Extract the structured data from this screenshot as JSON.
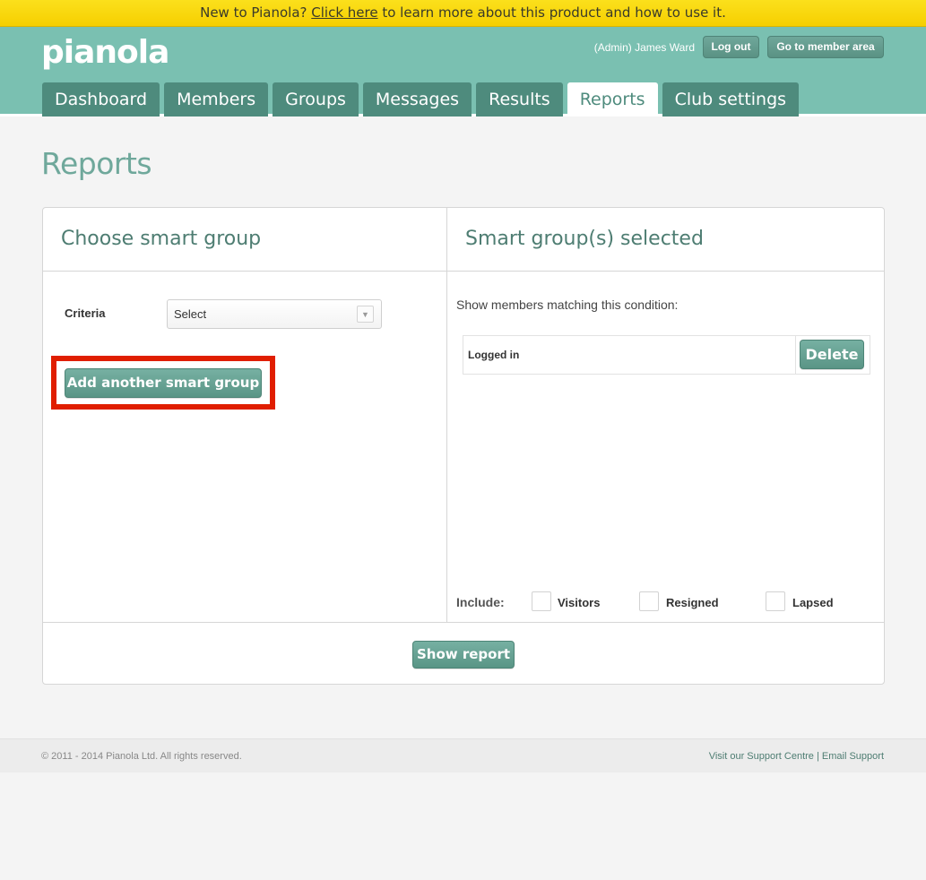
{
  "banner": {
    "prefix": "New to Pianola? ",
    "link": "Click here",
    "suffix": " to learn more about this product and how to use it."
  },
  "header": {
    "logo": "pianola",
    "admin_user": "(Admin) James Ward",
    "logout_label": "Log out",
    "member_area_label": "Go to member area"
  },
  "tabs": [
    {
      "label": "Dashboard",
      "active": false
    },
    {
      "label": "Members",
      "active": false
    },
    {
      "label": "Groups",
      "active": false
    },
    {
      "label": "Messages",
      "active": false
    },
    {
      "label": "Results",
      "active": false
    },
    {
      "label": "Reports",
      "active": true
    },
    {
      "label": "Club settings",
      "active": false
    }
  ],
  "page": {
    "title": "Reports"
  },
  "left_panel": {
    "heading": "Choose smart group",
    "criteria_label": "Criteria",
    "criteria_value": "Select",
    "add_button": "Add another smart group"
  },
  "right_panel": {
    "heading": "Smart group(s) selected",
    "condition_text": "Show members matching this condition:",
    "conditions": [
      {
        "name": "Logged in",
        "delete_label": "Delete"
      }
    ],
    "include_label": "Include:",
    "include_options": [
      {
        "label": "Visitors",
        "checked": false
      },
      {
        "label": "Resigned",
        "checked": false
      },
      {
        "label": "Lapsed",
        "checked": false
      }
    ]
  },
  "panel_footer": {
    "show_report": "Show report"
  },
  "footer": {
    "copyright": "© 2011 - 2014 Pianola Ltd. All rights reserved.",
    "support_centre": "Visit our Support Centre",
    "separator": "|",
    "email_support": "Email Support"
  },
  "colors": {
    "banner": "#f6cf00",
    "header": "#7ac0b1",
    "tab": "#4e8b7d",
    "highlight": "#e01e00"
  }
}
